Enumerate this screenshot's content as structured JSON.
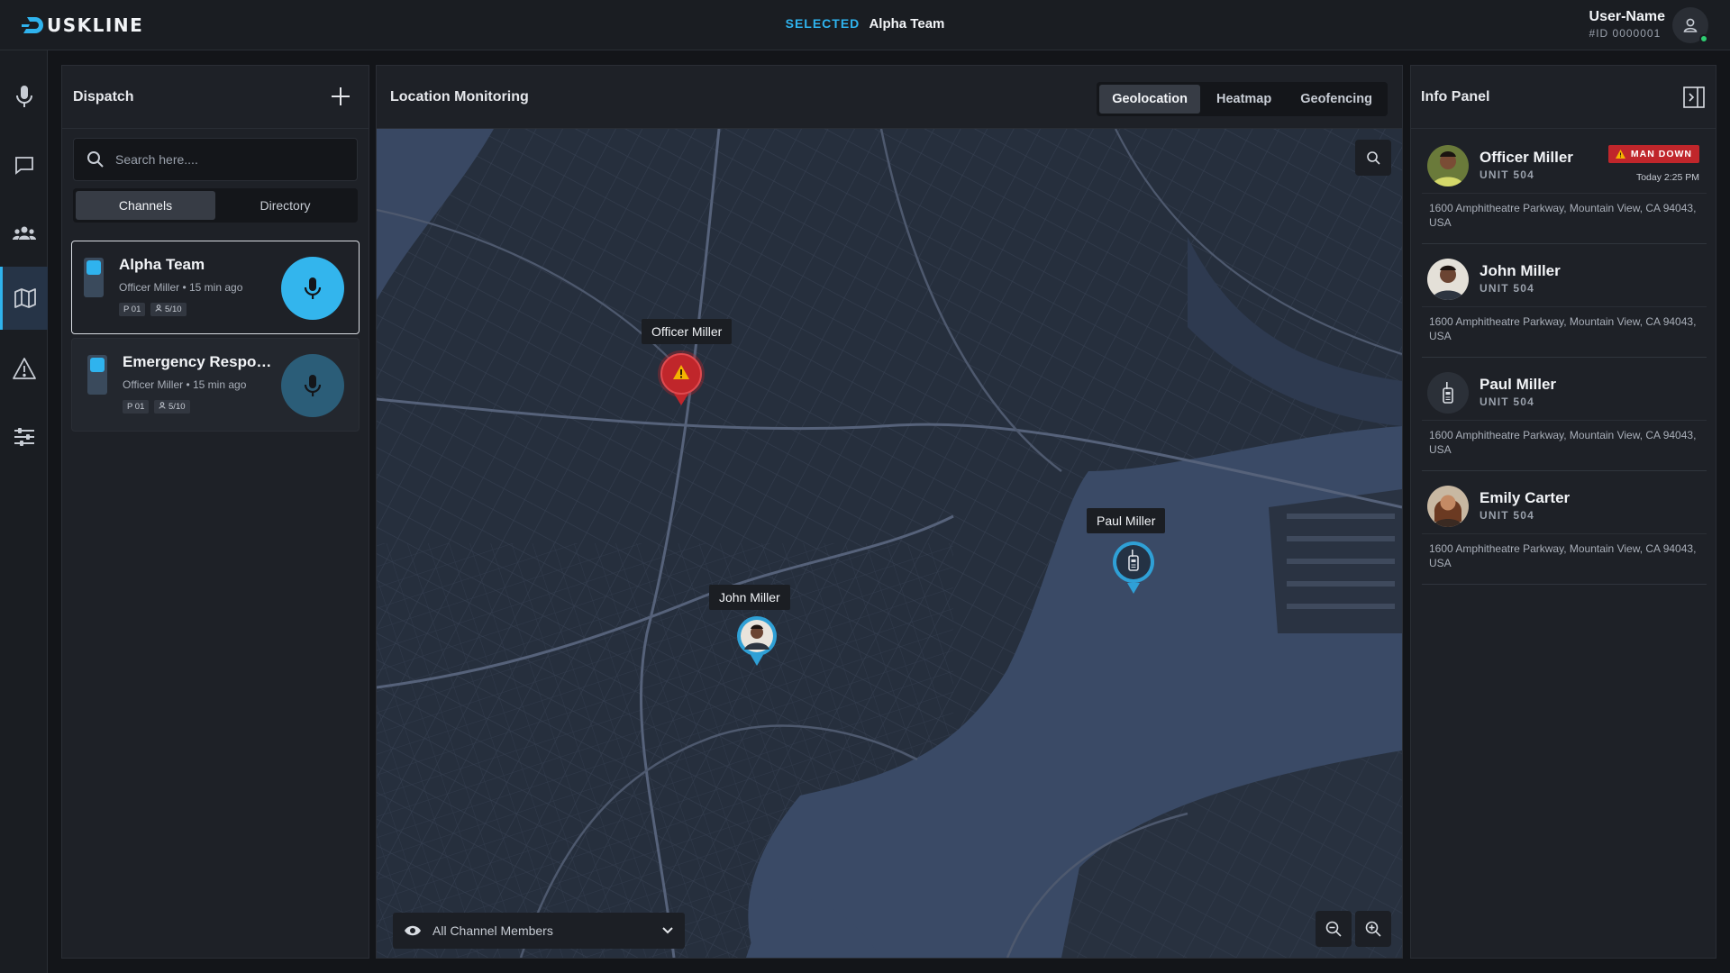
{
  "app": {
    "logo_text": "USKLINE"
  },
  "header": {
    "selected_label": "SELECTED",
    "selected_value": "Alpha Team"
  },
  "user": {
    "name": "User-Name",
    "id": "#ID 0000001",
    "status": "online"
  },
  "rail": {
    "items": [
      {
        "icon": "microphone-icon",
        "active": false
      },
      {
        "icon": "chat-icon",
        "active": false
      },
      {
        "icon": "group-icon",
        "active": false
      },
      {
        "icon": "map-icon",
        "active": true
      },
      {
        "icon": "alert-icon",
        "active": false
      },
      {
        "icon": "sliders-icon",
        "active": false
      }
    ]
  },
  "dispatch": {
    "title": "Dispatch",
    "search_placeholder": "Search here....",
    "tabs": [
      {
        "label": "Channels",
        "active": true
      },
      {
        "label": "Directory",
        "active": false
      }
    ],
    "channels": [
      {
        "title": "Alpha Team",
        "subtitle": "Officer Miller • 15 min ago",
        "tag_priority": "P 01",
        "tag_members": "5/10",
        "active": true
      },
      {
        "title": "Emergency Response Team",
        "subtitle": "Officer Miller • 15 min ago",
        "tag_priority": "P 01",
        "tag_members": "5/10",
        "active": false
      }
    ]
  },
  "map": {
    "title": "Location Monitoring",
    "tabs": [
      {
        "label": "Geolocation",
        "active": true
      },
      {
        "label": "Heatmap",
        "active": false
      },
      {
        "label": "Geofencing",
        "active": false
      }
    ],
    "pins": [
      {
        "label": "Officer Miller",
        "kind": "alert"
      },
      {
        "label": "John Miller",
        "kind": "avatar"
      },
      {
        "label": "Paul Miller",
        "kind": "radio"
      }
    ],
    "member_filter": "All Channel Members"
  },
  "info": {
    "title": "Info Panel",
    "officers": [
      {
        "name": "Officer Miller",
        "unit": "UNIT 504",
        "address": "1600 Amphitheatre Parkway, Mountain View, CA 94043, USA",
        "alert": "MAN DOWN",
        "time": "Today 2:25 PM",
        "avatar": "photo"
      },
      {
        "name": "John Miller",
        "unit": "UNIT 504",
        "address": "1600 Amphitheatre Parkway, Mountain View, CA 94043, USA",
        "alert": "",
        "time": "",
        "avatar": "photo"
      },
      {
        "name": "Paul Miller",
        "unit": "UNIT 504",
        "address": "1600 Amphitheatre Parkway, Mountain View, CA 94043, USA",
        "alert": "",
        "time": "",
        "avatar": "radio"
      },
      {
        "name": "Emily Carter",
        "unit": "UNIT 504",
        "address": "1600 Amphitheatre Parkway, Mountain View, CA 94043, USA",
        "alert": "",
        "time": "",
        "avatar": "photo"
      }
    ]
  },
  "colors": {
    "accent": "#2fb3ee",
    "alert": "#c0262b",
    "panel": "#1e2127",
    "map_land": "#27303e",
    "map_water": "#3a4a64"
  }
}
